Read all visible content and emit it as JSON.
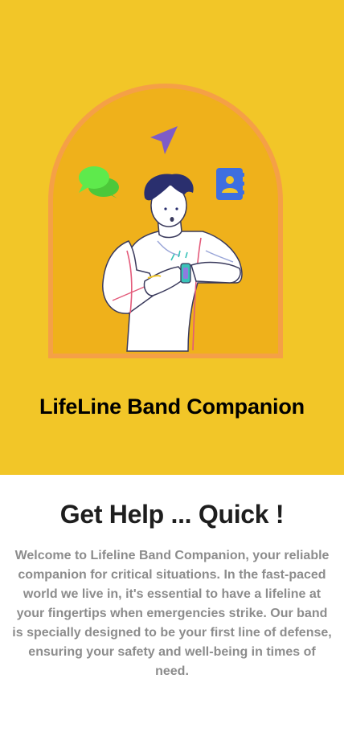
{
  "hero": {
    "app_name": "LifeLine Band Companion",
    "background_color": "#F2C628",
    "illustration": {
      "name": "person-checking-smart-band-illustration",
      "icons": [
        "chat-bubbles-icon",
        "navigation-arrow-icon",
        "contacts-book-icon"
      ],
      "arch_color": "#EFB11B",
      "arch_border_color": "#F5A046"
    }
  },
  "content": {
    "headline": "Get Help ... Quick !",
    "description": "Welcome to Lifeline Band Companion, your reliable companion for critical situations. In the fast-paced world we live in, it's essential to have a lifeline at your fingertips when emergencies strike. Our band is specially designed to be your first line of defense, ensuring your safety and well-being in times of need."
  }
}
